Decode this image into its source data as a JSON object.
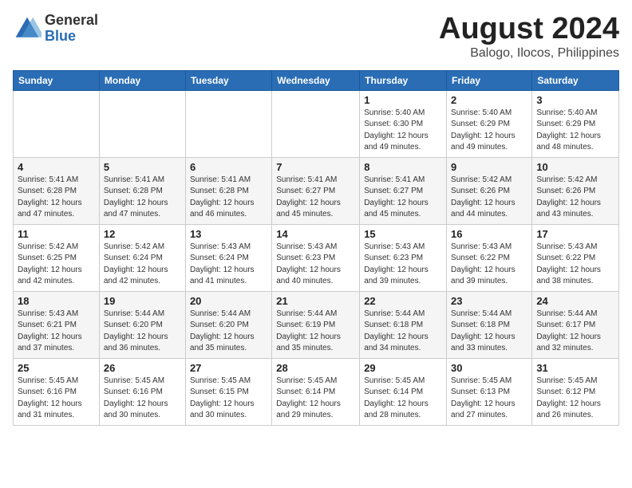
{
  "header": {
    "logo_line1": "General",
    "logo_line2": "Blue",
    "title": "August 2024",
    "location": "Balogo, Ilocos, Philippines"
  },
  "weekdays": [
    "Sunday",
    "Monday",
    "Tuesday",
    "Wednesday",
    "Thursday",
    "Friday",
    "Saturday"
  ],
  "weeks": [
    [
      {
        "day": "",
        "info": ""
      },
      {
        "day": "",
        "info": ""
      },
      {
        "day": "",
        "info": ""
      },
      {
        "day": "",
        "info": ""
      },
      {
        "day": "1",
        "info": "Sunrise: 5:40 AM\nSunset: 6:30 PM\nDaylight: 12 hours\nand 49 minutes."
      },
      {
        "day": "2",
        "info": "Sunrise: 5:40 AM\nSunset: 6:29 PM\nDaylight: 12 hours\nand 49 minutes."
      },
      {
        "day": "3",
        "info": "Sunrise: 5:40 AM\nSunset: 6:29 PM\nDaylight: 12 hours\nand 48 minutes."
      }
    ],
    [
      {
        "day": "4",
        "info": "Sunrise: 5:41 AM\nSunset: 6:28 PM\nDaylight: 12 hours\nand 47 minutes."
      },
      {
        "day": "5",
        "info": "Sunrise: 5:41 AM\nSunset: 6:28 PM\nDaylight: 12 hours\nand 47 minutes."
      },
      {
        "day": "6",
        "info": "Sunrise: 5:41 AM\nSunset: 6:28 PM\nDaylight: 12 hours\nand 46 minutes."
      },
      {
        "day": "7",
        "info": "Sunrise: 5:41 AM\nSunset: 6:27 PM\nDaylight: 12 hours\nand 45 minutes."
      },
      {
        "day": "8",
        "info": "Sunrise: 5:41 AM\nSunset: 6:27 PM\nDaylight: 12 hours\nand 45 minutes."
      },
      {
        "day": "9",
        "info": "Sunrise: 5:42 AM\nSunset: 6:26 PM\nDaylight: 12 hours\nand 44 minutes."
      },
      {
        "day": "10",
        "info": "Sunrise: 5:42 AM\nSunset: 6:26 PM\nDaylight: 12 hours\nand 43 minutes."
      }
    ],
    [
      {
        "day": "11",
        "info": "Sunrise: 5:42 AM\nSunset: 6:25 PM\nDaylight: 12 hours\nand 42 minutes."
      },
      {
        "day": "12",
        "info": "Sunrise: 5:42 AM\nSunset: 6:24 PM\nDaylight: 12 hours\nand 42 minutes."
      },
      {
        "day": "13",
        "info": "Sunrise: 5:43 AM\nSunset: 6:24 PM\nDaylight: 12 hours\nand 41 minutes."
      },
      {
        "day": "14",
        "info": "Sunrise: 5:43 AM\nSunset: 6:23 PM\nDaylight: 12 hours\nand 40 minutes."
      },
      {
        "day": "15",
        "info": "Sunrise: 5:43 AM\nSunset: 6:23 PM\nDaylight: 12 hours\nand 39 minutes."
      },
      {
        "day": "16",
        "info": "Sunrise: 5:43 AM\nSunset: 6:22 PM\nDaylight: 12 hours\nand 39 minutes."
      },
      {
        "day": "17",
        "info": "Sunrise: 5:43 AM\nSunset: 6:22 PM\nDaylight: 12 hours\nand 38 minutes."
      }
    ],
    [
      {
        "day": "18",
        "info": "Sunrise: 5:43 AM\nSunset: 6:21 PM\nDaylight: 12 hours\nand 37 minutes."
      },
      {
        "day": "19",
        "info": "Sunrise: 5:44 AM\nSunset: 6:20 PM\nDaylight: 12 hours\nand 36 minutes."
      },
      {
        "day": "20",
        "info": "Sunrise: 5:44 AM\nSunset: 6:20 PM\nDaylight: 12 hours\nand 35 minutes."
      },
      {
        "day": "21",
        "info": "Sunrise: 5:44 AM\nSunset: 6:19 PM\nDaylight: 12 hours\nand 35 minutes."
      },
      {
        "day": "22",
        "info": "Sunrise: 5:44 AM\nSunset: 6:18 PM\nDaylight: 12 hours\nand 34 minutes."
      },
      {
        "day": "23",
        "info": "Sunrise: 5:44 AM\nSunset: 6:18 PM\nDaylight: 12 hours\nand 33 minutes."
      },
      {
        "day": "24",
        "info": "Sunrise: 5:44 AM\nSunset: 6:17 PM\nDaylight: 12 hours\nand 32 minutes."
      }
    ],
    [
      {
        "day": "25",
        "info": "Sunrise: 5:45 AM\nSunset: 6:16 PM\nDaylight: 12 hours\nand 31 minutes."
      },
      {
        "day": "26",
        "info": "Sunrise: 5:45 AM\nSunset: 6:16 PM\nDaylight: 12 hours\nand 30 minutes."
      },
      {
        "day": "27",
        "info": "Sunrise: 5:45 AM\nSunset: 6:15 PM\nDaylight: 12 hours\nand 30 minutes."
      },
      {
        "day": "28",
        "info": "Sunrise: 5:45 AM\nSunset: 6:14 PM\nDaylight: 12 hours\nand 29 minutes."
      },
      {
        "day": "29",
        "info": "Sunrise: 5:45 AM\nSunset: 6:14 PM\nDaylight: 12 hours\nand 28 minutes."
      },
      {
        "day": "30",
        "info": "Sunrise: 5:45 AM\nSunset: 6:13 PM\nDaylight: 12 hours\nand 27 minutes."
      },
      {
        "day": "31",
        "info": "Sunrise: 5:45 AM\nSunset: 6:12 PM\nDaylight: 12 hours\nand 26 minutes."
      }
    ]
  ]
}
